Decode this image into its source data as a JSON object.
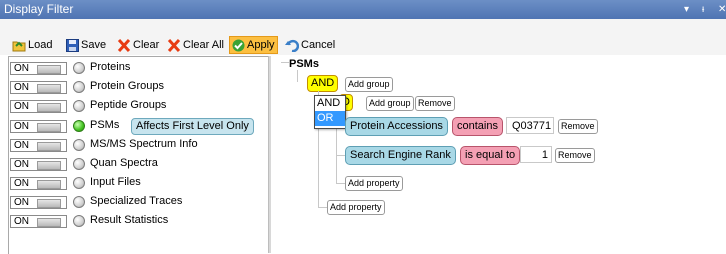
{
  "window": {
    "title": "Display Filter",
    "pin": "▾",
    "float": "ᵻ",
    "close": "✕"
  },
  "toolbar": {
    "load": "Load",
    "save": "Save",
    "clear": "Clear",
    "clear_all": "Clear All",
    "apply": "Apply",
    "cancel": "Cancel"
  },
  "filters": [
    {
      "toggle": "ON",
      "label": "Proteins",
      "active": false
    },
    {
      "toggle": "ON",
      "label": "Protein Groups",
      "active": false
    },
    {
      "toggle": "ON",
      "label": "Peptide Groups",
      "active": false
    },
    {
      "toggle": "ON",
      "label": "PSMs",
      "active": true,
      "badge": "Affects First Level Only"
    },
    {
      "toggle": "ON",
      "label": "MS/MS Spectrum Info",
      "active": false
    },
    {
      "toggle": "ON",
      "label": "Quan Spectra",
      "active": false
    },
    {
      "toggle": "ON",
      "label": "Input Files",
      "active": false
    },
    {
      "toggle": "ON",
      "label": "Specialized Traces",
      "active": false
    },
    {
      "toggle": "ON",
      "label": "Result Statistics",
      "active": false
    }
  ],
  "tree": {
    "root": "PSMs",
    "root_op": "AND",
    "add_group": "Add group",
    "inner_op_visible": "D",
    "remove": "Remove",
    "operator_menu": [
      "AND",
      "OR"
    ],
    "operator_menu_selected": "OR",
    "conditions": [
      {
        "property": "Protein Accessions",
        "operator": "contains",
        "value": "Q03771"
      },
      {
        "property": "Search Engine Rank",
        "operator": "is equal to",
        "value": "1"
      }
    ],
    "add_property": "Add property"
  },
  "colors": {
    "titlebar": "#4f74b3",
    "and_op": "#ffff00",
    "apply": "#fcbf41",
    "property": "#a8d8e6",
    "operator": "#f4a0b4",
    "badge": "#c7e4ee",
    "menu_selected": "#3399ff"
  }
}
